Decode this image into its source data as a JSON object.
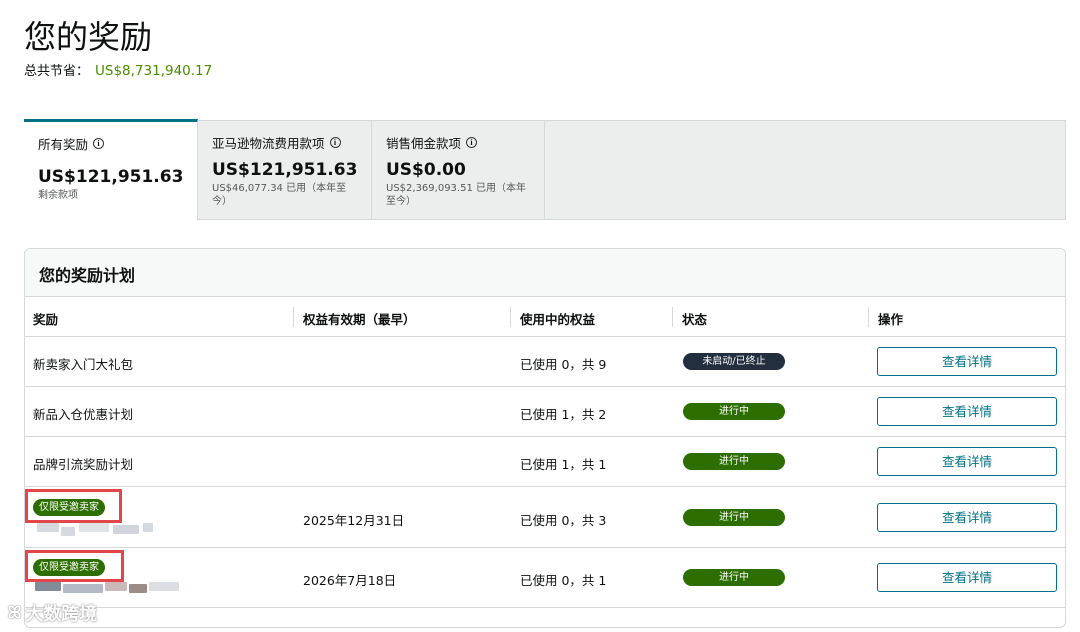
{
  "page": {
    "title": "您的奖励",
    "savings_label": "总共节省：",
    "savings_amount": "US$8,731,940.17"
  },
  "summary_tabs": [
    {
      "label": "所有奖励",
      "amount": "US$121,951.63",
      "sub": "剩余款项"
    },
    {
      "label": "亚马逊物流费用款项",
      "amount": "US$121,951.63",
      "sub": "US$46,077.34 已用（本年至今）"
    },
    {
      "label": "销售佣金款项",
      "amount": "US$0.00",
      "sub": "US$2,369,093.51 已用（本年至今）"
    }
  ],
  "programs": {
    "title": "您的奖励计划",
    "columns": [
      "奖励",
      "权益有效期（最早）",
      "使用中的权益",
      "状态",
      "操作"
    ],
    "rows": [
      {
        "name": "新卖家入门大礼包",
        "badge": "",
        "expiry": "",
        "usage": "已使用 0，共 9",
        "status": "未启动/已终止",
        "status_color": "#232f3e",
        "action": "查看详情"
      },
      {
        "name": "新品入仓优惠计划",
        "badge": "",
        "expiry": "",
        "usage": "已使用 1，共 2",
        "status": "进行中",
        "status_color": "#2c6e00",
        "action": "查看详情"
      },
      {
        "name": "品牌引流奖励计划",
        "badge": "",
        "expiry": "",
        "usage": "已使用 1，共 1",
        "status": "进行中",
        "status_color": "#2c6e00",
        "action": "查看详情"
      },
      {
        "name": "",
        "badge": "仅限受邀卖家",
        "expiry": "2025年12月31日",
        "usage": "已使用 0，共 3",
        "status": "进行中",
        "status_color": "#2c6e00",
        "action": "查看详情"
      },
      {
        "name": "",
        "badge": "仅限受邀卖家",
        "expiry": "2026年7月18日",
        "usage": "已使用 0，共 1",
        "status": "进行中",
        "status_color": "#2c6e00",
        "action": "查看详情"
      }
    ]
  },
  "watermark": {
    "text": "大数跨境",
    "icon": "watermark-logo-icon"
  },
  "colors": {
    "accent": "#007185",
    "savings": "#4b8a00",
    "status_active": "#2c6e00",
    "status_inactive": "#232f3e",
    "highlight": "#e2464b"
  }
}
